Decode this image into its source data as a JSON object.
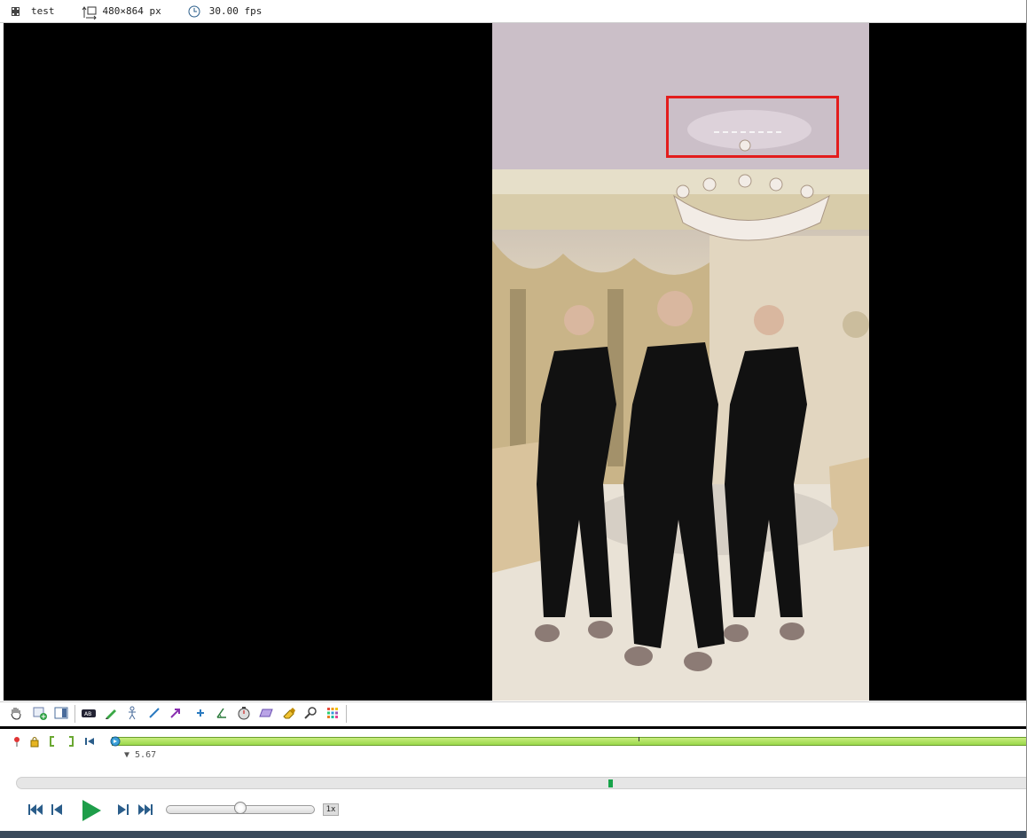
{
  "infobar": {
    "filename": "test",
    "resolution": "480×864 px",
    "framerate": "30.00 fps"
  },
  "icons": {
    "file": "film-strip-icon",
    "resolution": "resize-icon",
    "framerate": "clock-icon"
  },
  "colors": {
    "roi": "#e31d1d",
    "timeline_green": "#9ad84a",
    "play_green": "#1e9e4a",
    "transport_blue": "#2a5d8a"
  },
  "tools": [
    "hand-icon",
    "add-keyframe-icon",
    "comments-panel-icon",
    "label-icon",
    "pencil-icon",
    "human-model-icon",
    "line-icon",
    "arrow-icon",
    "cross-marker-icon",
    "angle-icon",
    "chronometer-icon",
    "plane-icon",
    "eraser-icon",
    "magnifier-icon",
    "color-grid-icon"
  ],
  "timeline": {
    "current_time": "▼ 5.67",
    "position_fraction": 0.6
  },
  "transport": {
    "speed_label": "1x",
    "speed_slider_fraction": 0.5
  }
}
